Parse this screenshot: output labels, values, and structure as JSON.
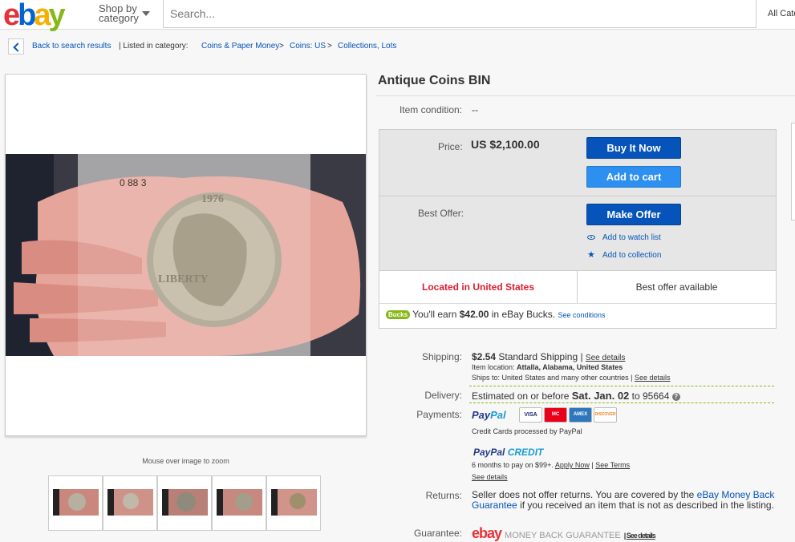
{
  "header": {
    "logo": [
      "e",
      "b",
      "a",
      "y"
    ],
    "shop_by_line1": "Shop by",
    "shop_by_line2": "category",
    "search_placeholder": "Search...",
    "all_categories": "All Cate"
  },
  "breadcrumb": {
    "back": "Back to search results",
    "listed": "| Listed in category:",
    "cat1": "Coins & Paper Money",
    "sep": ">",
    "cat2": "Coins: US",
    "cat3": "Collections, Lots"
  },
  "gallery": {
    "zoom_hint": "Mouse over image to zoom",
    "thumb_count": 5
  },
  "item": {
    "title": "Antique Coins BIN",
    "condition_label": "Item condition:",
    "condition_value": "--"
  },
  "buybox": {
    "price_label": "Price:",
    "price": "US $2,100.00",
    "buy_now": "Buy It Now",
    "add_to_cart": "Add to cart",
    "best_offer_label": "Best Offer:",
    "make_offer": "Make Offer",
    "watch": "Add to watch list",
    "collection": "Add to collection",
    "location": "Located in United States",
    "best_offer_available": "Best offer available",
    "bucks_badge": "Bucks",
    "bucks_prefix": "You'll earn",
    "bucks_amount": "$42.00",
    "bucks_suffix": "in eBay Bucks.",
    "bucks_conditions": "See conditions"
  },
  "shipping": {
    "label": "Shipping:",
    "amount": "$2.54",
    "method": "Standard Shipping",
    "see_details": "See details",
    "item_location_label": "Item location:",
    "item_location": "Attalla, Alabama, United States",
    "ships_to_label": "Ships to:",
    "ships_to": "United States and many other countries"
  },
  "delivery": {
    "label": "Delivery:",
    "prefix": "Estimated on or before",
    "date": "Sat. Jan. 02",
    "to": "to",
    "zip": "95664",
    "help": "?"
  },
  "payments": {
    "label": "Payments:",
    "paypal_1": "Pay",
    "paypal_2": "Pal",
    "cards": [
      "VISA",
      "MC",
      "AMEX",
      "DISCOVER"
    ],
    "processed": "Credit Cards processed by PayPal",
    "ppcredit_1": "PayPal",
    "ppcredit_2": "CREDIT",
    "months_text": "6 months to pay on $99+.",
    "apply_now": "Apply Now",
    "see_terms": "See Terms",
    "see_details": "See details"
  },
  "returns": {
    "label": "Returns:",
    "text_1": "Seller does not offer returns. You are covered by the",
    "link": "eBay Money Back Guarantee",
    "text_2": "if you received an item that is not as described in the listing."
  },
  "guarantee": {
    "label": "Guarantee:",
    "logo": "ebay",
    "mbg": "MONEY BACK GUARANTEE",
    "see_details": "See details"
  },
  "colors": {
    "link": "#0654ba",
    "buy_button": "#0654ba",
    "cart_button": "#2d8ff0",
    "location_red": "#dd1e31",
    "bucks_green": "#86b817"
  }
}
